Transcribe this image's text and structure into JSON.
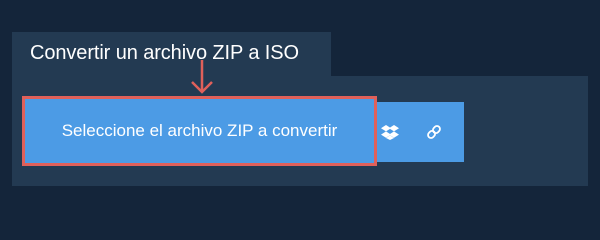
{
  "converter": {
    "title": "Convertir un archivo ZIP a ISO",
    "upload_label": "Seleccione el archivo ZIP a convertir"
  },
  "icons": {
    "pointer": "arrow-down-icon",
    "dropbox": "dropbox-icon",
    "link": "link-icon"
  },
  "colors": {
    "background": "#14253a",
    "panel": "#233a52",
    "button": "#4c9be5",
    "highlight": "#e0605a",
    "text": "#ffffff"
  }
}
